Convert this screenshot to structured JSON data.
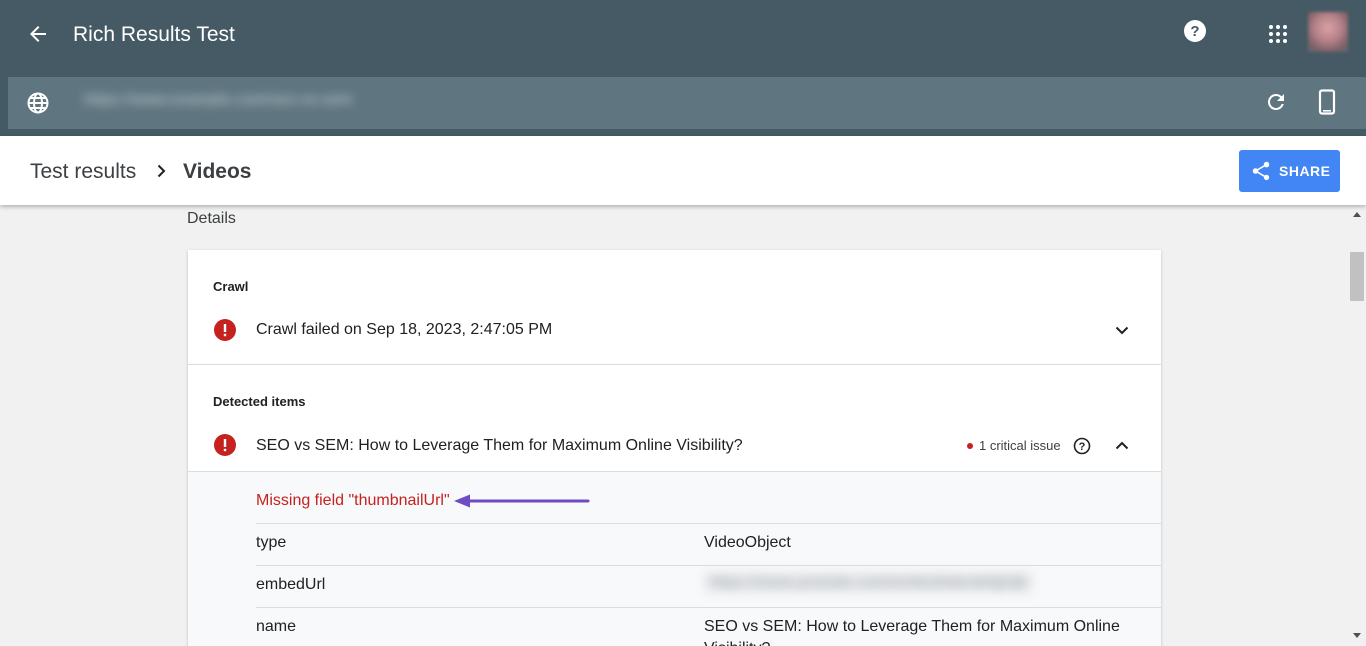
{
  "app": {
    "title": "Rich Results Test",
    "url": "https://www.example.com/seo-vs-sem"
  },
  "breadcrumb": {
    "root": "Test results",
    "current": "Videos"
  },
  "share_label": "SHARE",
  "details_label": "Details",
  "crawl": {
    "section_label": "Crawl",
    "status_text": "Crawl failed on Sep 18, 2023, 2:47:05 PM"
  },
  "detected": {
    "section_label": "Detected items",
    "item_title": "SEO vs SEM: How to Leverage Them for Maximum Online Visibility?",
    "issue_count": "1 critical issue",
    "missing_field": "Missing field \"thumbnailUrl\"",
    "properties": [
      {
        "key": "type",
        "value": "VideoObject"
      },
      {
        "key": "embedUrl",
        "value": "https://www.youtube.com/embed/abcdefghijk"
      },
      {
        "key": "name",
        "value": "SEO vs SEM: How to Leverage Them for Maximum Online Visibility?"
      }
    ]
  },
  "colors": {
    "appbar": "#455a64",
    "urlbar": "#5f7580",
    "share": "#4285f4",
    "error": "#c5221f",
    "annotation_arrow": "#6f4cc4"
  }
}
